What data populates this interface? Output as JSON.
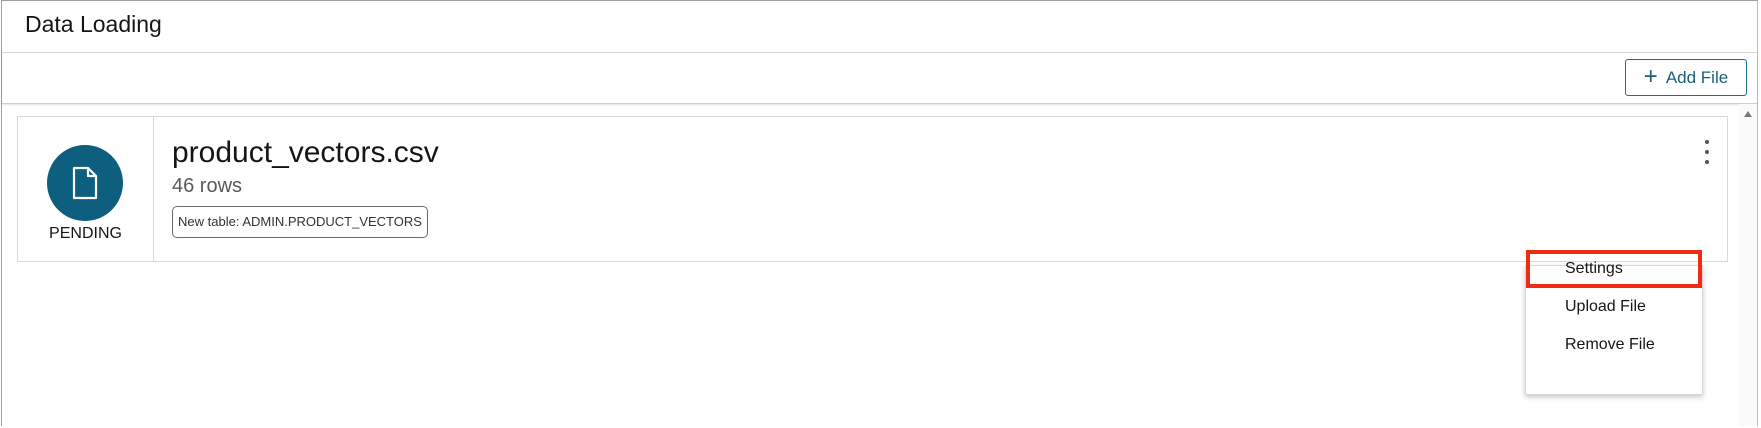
{
  "header": {
    "title": "Data Loading"
  },
  "toolbar": {
    "add_file_label": "Add File",
    "add_file_icon": "plus-icon"
  },
  "file_card": {
    "icon": "file-icon",
    "status": "PENDING",
    "file_name": "product_vectors.csv",
    "rows": "46 rows",
    "table_chip": "New table: ADMIN.PRODUCT_VECTORS",
    "menu_icon": "kebab-menu-icon"
  },
  "context_menu": {
    "items": [
      {
        "label": "Settings",
        "highlighted": true
      },
      {
        "label": "Upload File",
        "highlighted": false
      },
      {
        "label": "Remove File",
        "highlighted": false
      }
    ],
    "highlight_color": "#ee2c14"
  },
  "colors": {
    "accent": "#0e5e80",
    "button_text": "#1a5e78"
  }
}
